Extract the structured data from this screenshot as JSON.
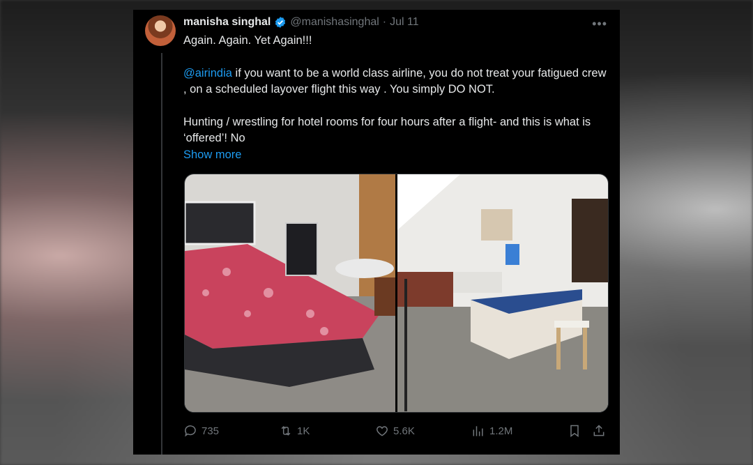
{
  "tweet": {
    "author_name": "manisha singhal",
    "handle": "@manishasinghal",
    "separator": "·",
    "date": "Jul 11",
    "more_label": "•••",
    "line1": "Again. Again. Yet Again!!!",
    "mention": "@airindia",
    "line2_rest": " if you want to be a world class airline, you do not treat your fatigued crew , on a scheduled layover flight this way . You simply DO NOT.",
    "line3": "Hunting / wrestling for hotel rooms for four hours after a flight- and this is what is ‘offered’! No",
    "show_more": "Show more"
  },
  "stats": {
    "replies": "735",
    "reposts": "1K",
    "likes": "5.6K",
    "views": "1.2M"
  },
  "icons": [
    "verified-badge-icon",
    "more-icon",
    "reply-icon",
    "repost-icon",
    "like-icon",
    "views-icon",
    "bookmark-icon",
    "share-icon"
  ],
  "colors": {
    "accent": "#1d9bf0",
    "text": "#e7e9ea",
    "muted": "#71767b",
    "background": "#000000"
  }
}
